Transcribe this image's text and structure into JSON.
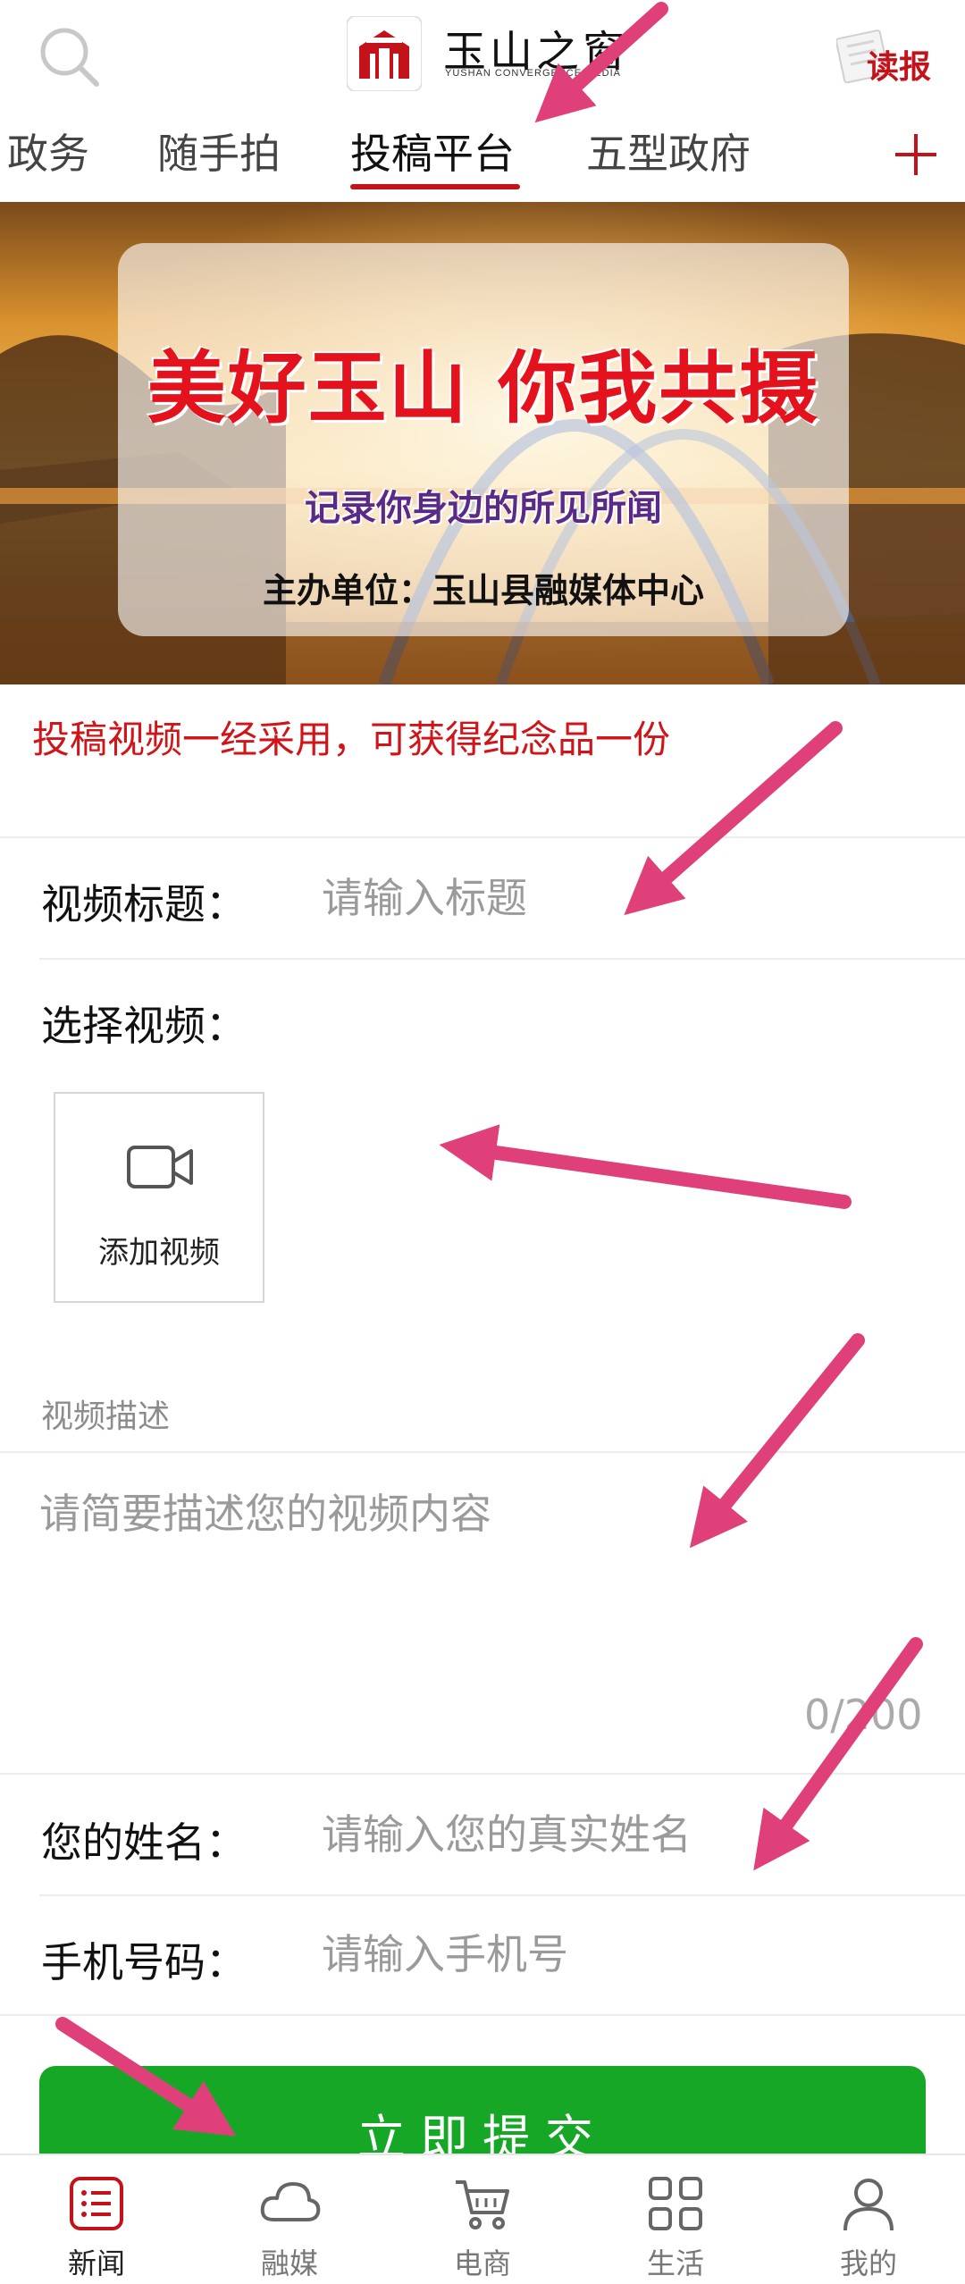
{
  "header": {
    "logo_title": "玉山之窗",
    "logo_subtitle": "YUSHAN CONVERGENCE MEDIA",
    "paper_label": "读报",
    "search_icon": "search-icon"
  },
  "tabs": {
    "items": [
      "政务",
      "随手拍",
      "投稿平台",
      "五型政府"
    ],
    "active": "投稿平台"
  },
  "banner": {
    "headline": "美好玉山 你我共摄",
    "subtitle": "记录你身边的所见所闻",
    "organizer": "主办单位：玉山县融媒体中心"
  },
  "notice": "投稿视频一经采用，可获得纪念品一份",
  "form": {
    "title_label": "视频标题：",
    "title_placeholder": "请输入标题",
    "select_video_label": "选择视频：",
    "add_video_label": "添加视频",
    "description_label": "视频描述",
    "description_placeholder": "请简要描述您的视频内容",
    "description_counter": "0/200",
    "name_label": "您的姓名：",
    "name_placeholder": "请输入您的真实姓名",
    "phone_label": "手机号码：",
    "phone_placeholder": "请输入手机号",
    "submit_label": "立即提交"
  },
  "bottom_nav": {
    "items": [
      {
        "label": "新闻",
        "icon": "news-list-icon",
        "active": true
      },
      {
        "label": "融媒",
        "icon": "cloud-icon",
        "active": false
      },
      {
        "label": "电商",
        "icon": "cart-icon",
        "active": false
      },
      {
        "label": "生活",
        "icon": "grid-icon",
        "active": false
      },
      {
        "label": "我的",
        "icon": "user-icon",
        "active": false
      }
    ]
  },
  "colors": {
    "brand_red": "#c4121a",
    "submit_green": "#17a726",
    "annotation_arrow": "#e0407a"
  }
}
